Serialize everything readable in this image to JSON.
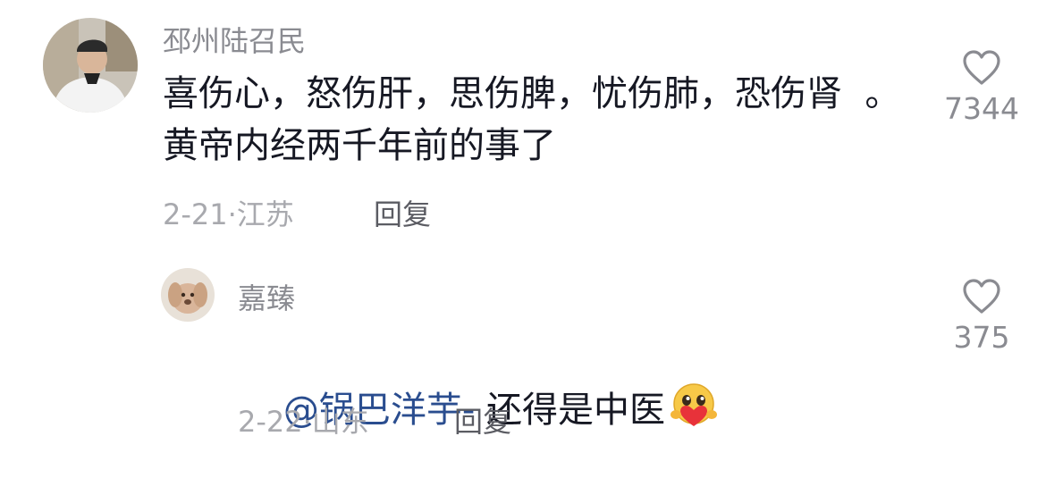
{
  "comments": [
    {
      "username": "邳州陆召民",
      "content": "喜伤心，怒伤肝，思伤脾，忧伤肺，恐伤肾  。黄帝内经两千年前的事了",
      "date": "2-21·",
      "location": "江苏",
      "reply_label": "回复",
      "likes": "7344",
      "avatar_icon": "elderly-man-avatar"
    },
    {
      "username": "嘉臻",
      "mention": "@锅巴洋芋-",
      "content": " 还得是中医",
      "emoji_icon": "smiling-face-holding-heart-emoji",
      "date": "2-22·",
      "location": "山东",
      "reply_label": "回复",
      "likes": "375",
      "avatar_icon": "plush-dog-avatar"
    }
  ],
  "colors": {
    "text": "#161823",
    "username": "#8a8b91",
    "meta": "#a8a9ae",
    "mention": "#2a4d8f",
    "heart": "#8a8b91"
  }
}
